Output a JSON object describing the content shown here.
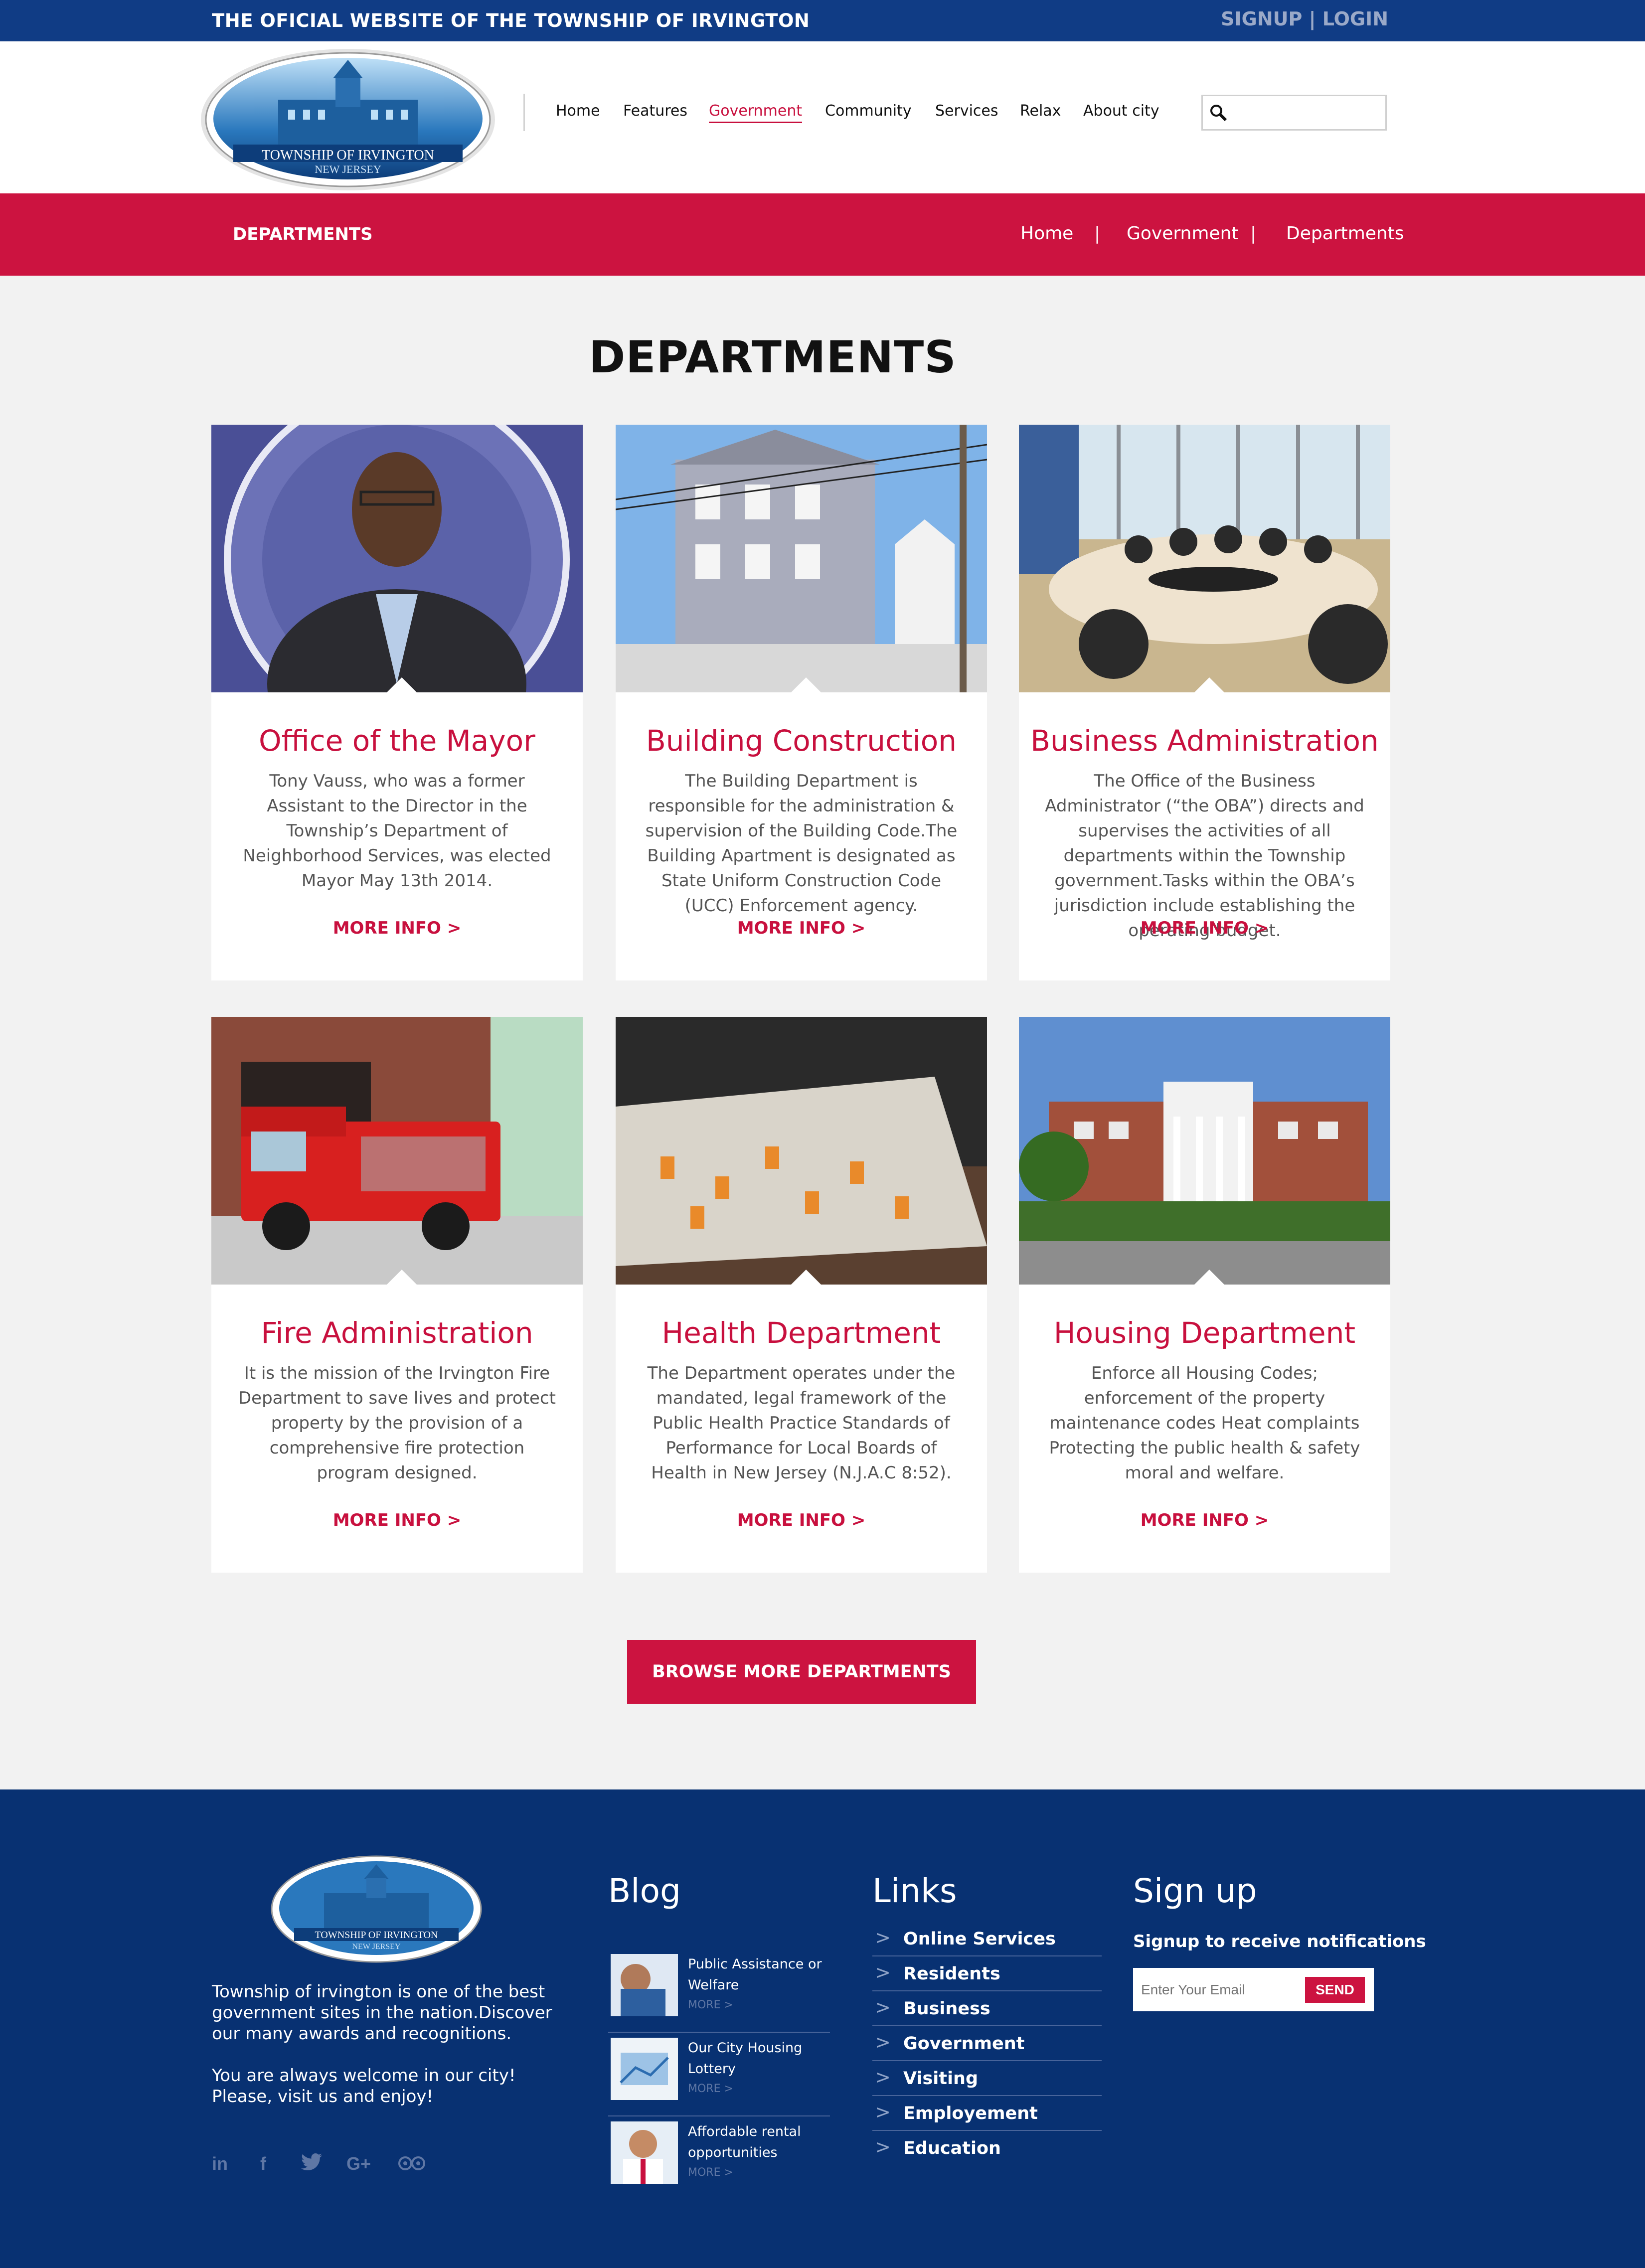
{
  "topbar": {
    "title": "THE OFICIAL WEBSITE OF THE TOWNSHIP OF IRVINGTON",
    "signup": "SIGNUP",
    "sep": "|",
    "login": "LOGIN"
  },
  "logo": {
    "line1": "TOWNSHIP OF IRVINGTON",
    "line2": "NEW JERSEY"
  },
  "nav": [
    {
      "label": "Home"
    },
    {
      "label": "Features"
    },
    {
      "label": "Government"
    },
    {
      "label": "Community"
    },
    {
      "label": "Services"
    },
    {
      "label": "Relax"
    },
    {
      "label": "About city"
    }
  ],
  "search": {
    "placeholder": "",
    "icon": "search-icon"
  },
  "banner": {
    "label": "DEPARTMENTS",
    "crumbs": [
      "Home",
      "Government",
      "Departments"
    ],
    "sep": "|"
  },
  "page_title": "DEPARTMENTS",
  "cards": [
    {
      "title": "Office of the Mayor",
      "text": "Tony Vauss, who was a former Assistant to the Director in the Township’s Department of Neighborhood Services, was elected Mayor May 13th 2014.",
      "more": "MORE INFO >"
    },
    {
      "title": "Building Construction",
      "text": "The Building Department is responsible for the administration & supervision of the Building Code.The Building Apartment is designated as State Uniform Construction Code (UCC) Enforcement agency.",
      "more": "MORE INFO >"
    },
    {
      "title": "Business Administration",
      "text": "The Office of the Business Administrator (“the OBA”) directs and supervises the activities of all departments within the Township government.Tasks within the OBA’s jurisdiction include establishing the operating budget.",
      "more": "MORE INFO >"
    },
    {
      "title": "Fire Administration",
      "text": "It is the mission of the Irvington Fire Department to save lives and protect property by the provision of a comprehensive fire protection program designed.",
      "more": "MORE INFO >"
    },
    {
      "title": "Health Department",
      "text": "The Department operates under the mandated, legal framework of the Public Health Practice Standards of Performance for Local Boards of Health in New Jersey (N.J.A.C 8:52).",
      "more": "MORE INFO >"
    },
    {
      "title": "Housing Department",
      "text": "Enforce all Housing Codes; enforcement of the property maintenance codes Heat complaints Protecting the public health & safety moral and welfare.",
      "more": "MORE INFO >"
    }
  ],
  "browse": "BROWSE MORE DEPARTMENTS",
  "footer": {
    "about1": "Township of irvington is one of the best government sites in the nation.Discover our many awards and recognitions.",
    "about2": "You are always welcome in our city! Please, visit us and enjoy!",
    "social": [
      "linkedin-icon",
      "facebook-icon",
      "twitter-icon",
      "googleplus-icon",
      "tripadvisor-icon"
    ],
    "blog_title": "Blog",
    "blog": [
      {
        "title": "Public Assistance or Welfare",
        "more": "MORE  >"
      },
      {
        "title": "Our City Housing Lottery",
        "more": "MORE  >"
      },
      {
        "title": "Affordable rental opportunities",
        "more": "MORE  >"
      }
    ],
    "links_title": "Links",
    "links": [
      "Online Services",
      "Residents",
      "Business",
      "Government",
      "Visiting",
      "Employement",
      "Education"
    ],
    "signup_title": "Sign up",
    "signup_sub": "Signup to receive notifications",
    "email_placeholder": "Enter Your Email",
    "send": "SEND"
  },
  "colors": {
    "navy": "#103c85",
    "red": "#cc1340",
    "footer": "#083172"
  }
}
